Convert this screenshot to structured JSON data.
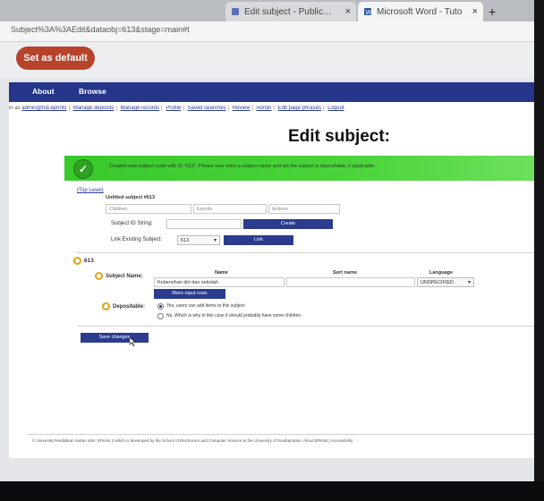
{
  "browser": {
    "tabs": [
      {
        "label": "Edit subject - Public…",
        "close": "×"
      },
      {
        "label": "Microsoft Word - Tuto",
        "close": "×"
      }
    ],
    "new_tab": "+",
    "address": "Subject%3A%3AEdit&dataobj=613&stage=main#t",
    "set_default_label": "Set as default"
  },
  "nav": {
    "items": [
      "About",
      "Browse"
    ]
  },
  "links": {
    "prefix": "in as",
    "items": [
      "admin@tsb.eprints",
      "Manage deposits",
      "Manage records",
      "Profile",
      "Saved searches",
      "Review",
      "Admin",
      "Edit page phrases",
      "Logout"
    ]
  },
  "page_title": "Edit subject:",
  "banner": {
    "message": "Created new subject node with ID \"613\". Please now enter a subject name and set the subject is depositable, if applicable."
  },
  "tree": {
    "top_link": "(Top Level)",
    "untitled": "Untitled subject #613",
    "children_placeholder": "Children",
    "eprints_placeholder": "Eprints",
    "actions_placeholder": "Actions",
    "id_label": "Subject ID String:",
    "create_label": "Create",
    "link_label": "Link Existing Subject:",
    "link_select": "613",
    "link_button": "Link"
  },
  "form": {
    "id": "613",
    "subject_name_label": "Subject Name:",
    "col_name": "Name",
    "col_sort": "Sort name",
    "col_lang": "Language",
    "name_value": "Kebersihan diri dan sekolah",
    "lang_value": "UNSPECIFIED",
    "more_rows": "More input rows",
    "depositable_label": "Depositable:",
    "opt_yes": "Yes, users can add items to this subject",
    "opt_no": "No. Which is why in this case it should probably have some children.",
    "save_label": "Save changes"
  },
  "footer": {
    "text": "© Universiti Pendidikan Sultan Idris. EPrints 3 which is developed by the School of Electronics and Computer Science at the University of Southampton. About EPrints | Accessibility"
  }
}
